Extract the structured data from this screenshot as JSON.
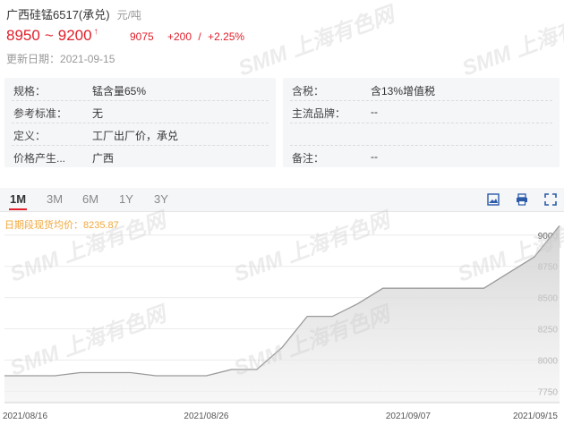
{
  "header": {
    "title": "广西硅锰6517(承兑)",
    "unit": "元/吨",
    "price_low": "8950",
    "tilde": "~",
    "price_high": "9200",
    "avg_price": "9075",
    "change": "+200",
    "separator": "/",
    "change_pct": "+2.25%",
    "updated_label": "更新日期：",
    "updated_date": "2021-09-15"
  },
  "info_left": [
    {
      "label": "规格：",
      "value": "锰含量65%"
    },
    {
      "label": "参考标准：",
      "value": "无"
    },
    {
      "label": "定义：",
      "value": "工厂出厂价，承兑"
    },
    {
      "label": "价格产生...",
      "value": "广西"
    }
  ],
  "info_right": [
    {
      "label": "含税：",
      "value": "含13%增值税"
    },
    {
      "label": "主流品牌：",
      "value": "--"
    },
    {
      "label": "",
      "value": ""
    },
    {
      "label": "备注：",
      "value": "--"
    }
  ],
  "tabs": [
    {
      "label": "1M",
      "active": true
    },
    {
      "label": "3M",
      "active": false
    },
    {
      "label": "6M",
      "active": false
    },
    {
      "label": "1Y",
      "active": false
    },
    {
      "label": "3Y",
      "active": false
    }
  ],
  "toolbar": {
    "icons": [
      "image-save-icon",
      "print-icon",
      "fullscreen-icon"
    ]
  },
  "colors": {
    "up": "#e0202b",
    "accent": "#f0a73b",
    "panel_bg": "#f5f6f8",
    "line": "#9a9a9a"
  },
  "chart_data": {
    "type": "area",
    "avg_label": "日期段现货均价：8235.87",
    "x": [
      "2021-08-16",
      "2021-08-17",
      "2021-08-18",
      "2021-08-19",
      "2021-08-20",
      "2021-08-23",
      "2021-08-24",
      "2021-08-25",
      "2021-08-26",
      "2021-08-27",
      "2021-08-30",
      "2021-08-31",
      "2021-09-01",
      "2021-09-02",
      "2021-09-03",
      "2021-09-06",
      "2021-09-07",
      "2021-09-08",
      "2021-09-09",
      "2021-09-10",
      "2021-09-13",
      "2021-09-14",
      "2021-09-15"
    ],
    "values": [
      7875,
      7875,
      7875,
      7900,
      7900,
      7900,
      7875,
      7875,
      7875,
      7925,
      7925,
      8100,
      8350,
      8350,
      8450,
      8575,
      8575,
      8575,
      8575,
      8575,
      8700,
      8825,
      9075
    ],
    "x_tick_labels": [
      "2021/08/16",
      "2021/08/26",
      "2021/09/07",
      "2021/09/15"
    ],
    "x_tick_indices": [
      0,
      8,
      16,
      22
    ],
    "y_ticks": [
      "7750",
      "8000",
      "8250",
      "8500",
      "8750",
      "9000"
    ],
    "ylim": [
      7660,
      9120
    ],
    "grid": true
  },
  "watermark": "SMM 上海有色网"
}
